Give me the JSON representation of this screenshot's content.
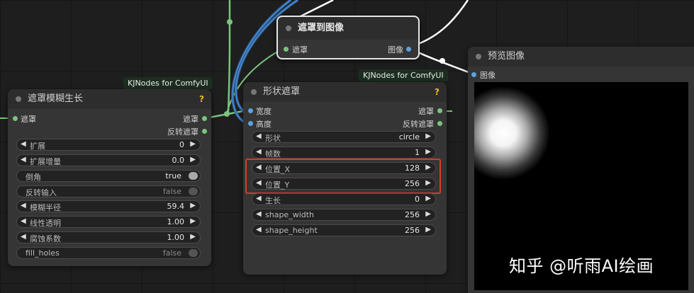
{
  "nodes": {
    "grow_mask": {
      "badge": "KJNodes for ComfyUI",
      "title": "遮罩模糊生长",
      "help": "?",
      "input": "遮罩",
      "outputs": [
        "遮罩",
        "反转遮罩"
      ],
      "widgets": [
        {
          "label": "扩展",
          "value": "0"
        },
        {
          "label": "扩展增量",
          "value": "0.0"
        },
        {
          "label": "倒角",
          "value": "true"
        },
        {
          "label": "反转输入",
          "value": "false"
        },
        {
          "label": "模糊半径",
          "value": "59.4"
        },
        {
          "label": "线性透明",
          "value": "1.00"
        },
        {
          "label": "腐蚀系数",
          "value": "1.00"
        },
        {
          "label": "fill_holes",
          "value": "false"
        }
      ]
    },
    "mask_to_image": {
      "title": "遮罩到图像",
      "input": "遮罩",
      "output": "图像"
    },
    "shape_mask": {
      "badge": "KJNodes for ComfyUI",
      "title": "形状遮罩",
      "help": "?",
      "inputs": [
        "宽度",
        "高度"
      ],
      "outputs": [
        "遮罩",
        "反转遮罩"
      ],
      "widgets": [
        {
          "label": "形状",
          "value": "circle"
        },
        {
          "label": "帧数",
          "value": "1"
        },
        {
          "label": "位置_X",
          "value": "128"
        },
        {
          "label": "位置_Y",
          "value": "256"
        },
        {
          "label": "生长",
          "value": "0"
        },
        {
          "label": "shape_width",
          "value": "256"
        },
        {
          "label": "shape_height",
          "value": "256"
        }
      ]
    },
    "preview_image": {
      "title": "预览图像",
      "input": "图像"
    }
  },
  "watermark": "知乎 @听雨AI绘画",
  "colors": {
    "mask_wire": "#7bc47f",
    "image_wire": "#ffffff",
    "int_wire": "#4a90d9",
    "highlight": "#d93a2b",
    "help_icon": "#f0b92f"
  }
}
